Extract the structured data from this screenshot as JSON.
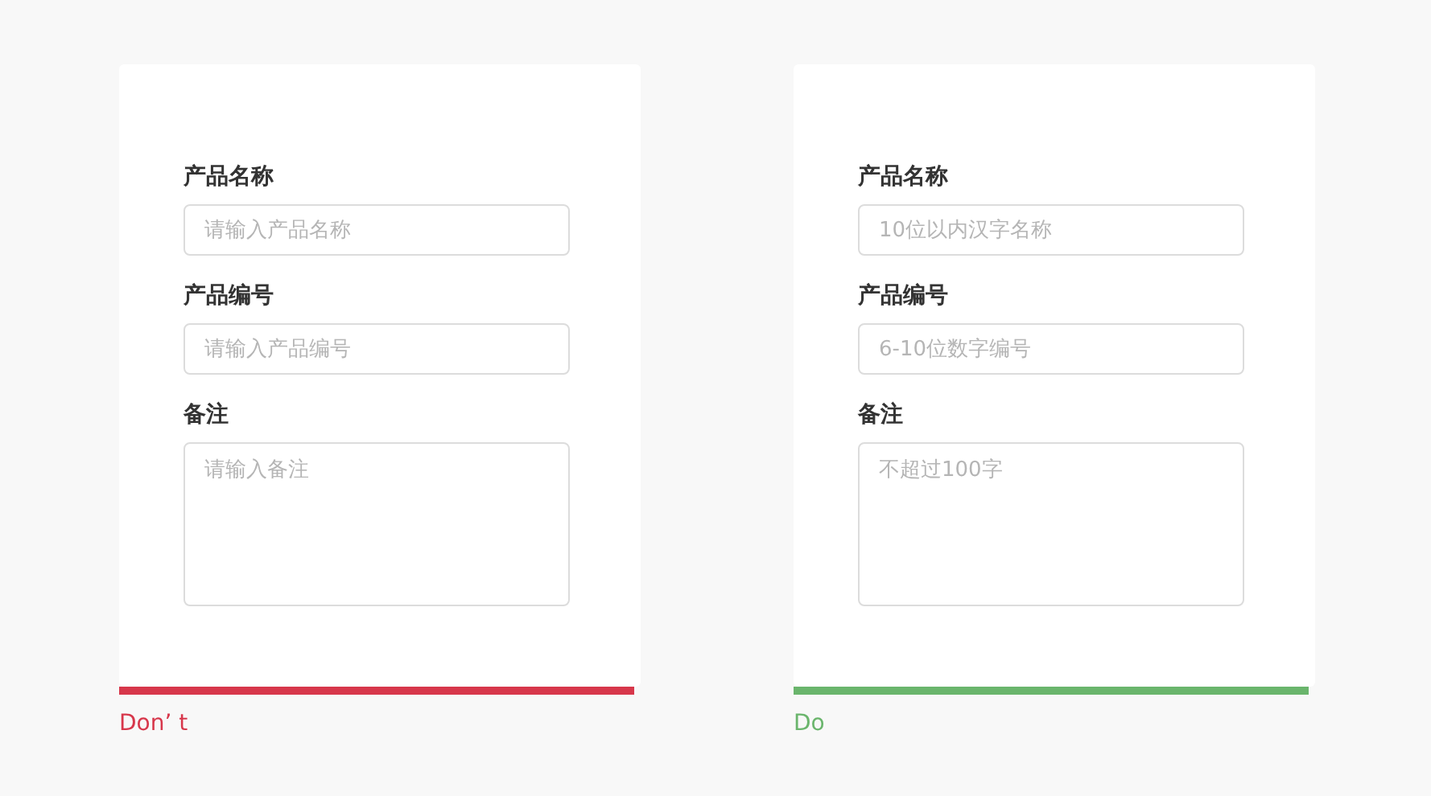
{
  "examples": [
    {
      "kind": "dont",
      "fields": [
        {
          "label": "产品名称",
          "kind": "input",
          "placeholder": "请输入产品名称"
        },
        {
          "label": "产品编号",
          "kind": "input",
          "placeholder": "请输入产品编号"
        },
        {
          "label": "备注",
          "kind": "textarea",
          "placeholder": "请输入备注"
        }
      ],
      "caption": "Don’ t"
    },
    {
      "kind": "do",
      "fields": [
        {
          "label": "产品名称",
          "kind": "input",
          "placeholder": "10位以内汉字名称"
        },
        {
          "label": "产品编号",
          "kind": "input",
          "placeholder": "6-10位数字编号"
        },
        {
          "label": "备注",
          "kind": "textarea",
          "placeholder": "不超过100字"
        }
      ],
      "caption": "Do"
    }
  ]
}
